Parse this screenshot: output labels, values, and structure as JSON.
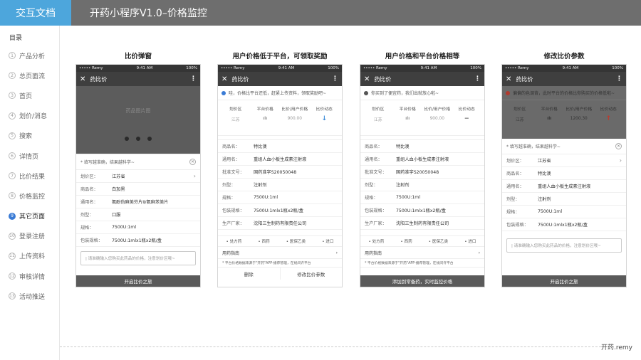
{
  "header": {
    "brand": "交互文档",
    "title": "开药小程序V1.0–价格监控"
  },
  "sidebar": {
    "title": "目录",
    "items": [
      {
        "num": "1",
        "label": "产品分析"
      },
      {
        "num": "2",
        "label": "总页面流"
      },
      {
        "num": "3",
        "label": "首页"
      },
      {
        "num": "4",
        "label": "划价/消息"
      },
      {
        "num": "5",
        "label": "搜索"
      },
      {
        "num": "6",
        "label": "详情页"
      },
      {
        "num": "7",
        "label": "比价结果"
      },
      {
        "num": "8",
        "label": "价格监控"
      },
      {
        "num": "9",
        "label": "其它页面",
        "active": true
      },
      {
        "num": "10",
        "label": "登录注册"
      },
      {
        "num": "11",
        "label": "上传资料"
      },
      {
        "num": "12",
        "label": "审核详情"
      },
      {
        "num": "13",
        "label": "活动推送"
      }
    ]
  },
  "footer": {
    "text": "开药.remy"
  },
  "colors": {
    "brand": "#4da6dc",
    "topbar": "#6e6e6e",
    "active": "#3a7bd5",
    "down_arrow": "#3a8ad8",
    "up_arrow": "#c0392b",
    "info_blue": "#3a7bd5",
    "info_dark": "#555555",
    "info_red": "#b03a2e"
  },
  "status_bar": {
    "carrier": "••••• Remy",
    "time": "9:41 AM",
    "battery": "100%"
  },
  "nav": {
    "close": "✕",
    "title": "药比价",
    "more": "⋮"
  },
  "screens": [
    {
      "title": "比价弹窗",
      "banner_placeholder": "药品图片图",
      "hint": "* 填写越准确，结果越科学~",
      "rows": [
        {
          "k": "划价区：",
          "v": "江苏省",
          "arrow": "›"
        },
        {
          "k": "商品名：",
          "v": "白加黑"
        },
        {
          "k": "通用名：",
          "v": "氨酚伪麻美芬片Ⅱ/氨麻苯美片"
        },
        {
          "k": "剂型：",
          "v": "口服"
        },
        {
          "k": "规格：",
          "v": "7500U:1ml"
        },
        {
          "k": "包装规格：",
          "v": "7500U:1mlx1瓶x2瓶/盒"
        }
      ],
      "input_placeholder": "| 请准确输入您购买此药品的价格，注意划价区哦~",
      "button": "开启比价之旅"
    },
    {
      "title": "用户价格低于平台，可领取奖励",
      "notice": "哇，价格比平台还低，赶紧上传资料，领取奖励吧~",
      "table_head": [
        "划价区",
        "平台价格",
        "比价/用户价格",
        "比价动态"
      ],
      "table_row": [
        "江苏",
        "",
        "900.00",
        "↓"
      ],
      "rows": [
        {
          "k": "商品名：",
          "v": "特比澳"
        },
        {
          "k": "通用名：",
          "v": "重组人血小板生成素注射液"
        },
        {
          "k": "批准文号：",
          "v": "国药准字S20050048"
        },
        {
          "k": "剂型：",
          "v": "注射剂"
        },
        {
          "k": "规格：",
          "v": "7500U:1ml"
        },
        {
          "k": "包装规格：",
          "v": "7500U:1mlx1瓶x2瓶/盒"
        },
        {
          "k": "生产厂家：",
          "v": "沈阳三生制药有限责任公司"
        }
      ],
      "tags": [
        "• 处方药",
        "• 西药",
        "• 医保乙类",
        "• 进口"
      ],
      "guide": "用药指南",
      "note": "* 平台价格数据来源于\"开药\"APP-播荐管理，在规间许平台",
      "btn_left": "删除",
      "btn_right": "修改比价参数"
    },
    {
      "title": "用户价格和平台价格相等",
      "notice": "你买到了便宜药，我们出就放心啦~",
      "table_head": [
        "划价区",
        "平台价格",
        "比价/用户价格",
        "比价动态"
      ],
      "table_row": [
        "江苏",
        "",
        "900.00",
        "—"
      ],
      "rows": [
        {
          "k": "商品名：",
          "v": "特比澳"
        },
        {
          "k": "通用名：",
          "v": "重组人血小板生成素注射液"
        },
        {
          "k": "批准文号：",
          "v": "国药准字S20050048"
        },
        {
          "k": "剂型：",
          "v": "注射剂"
        },
        {
          "k": "规格：",
          "v": "7500U:1ml"
        },
        {
          "k": "包装规格：",
          "v": "7500U:1mlx1瓶x2瓶/盒"
        },
        {
          "k": "生产厂家：",
          "v": "沈阳三生制药有限责任公司"
        }
      ],
      "tags": [
        "• 处方药",
        "• 西药",
        "• 医保乙类",
        "• 进口"
      ],
      "guide": "用药指南",
      "note": "* 平台价格数据来源于\"开药\"APP-播荐管理，在规间许平台",
      "button": "添加到常备药，实时监控价格"
    },
    {
      "title": "修改比价参数",
      "notice": "偏偏的色调背，此时平台的价格比你购买的价格低啦~",
      "table_head": [
        "划价区",
        "平台价格",
        "比价/用户价格",
        "比价动态"
      ],
      "table_row": [
        "江苏",
        "",
        "1200.30",
        "↑"
      ],
      "hint": "* 填写越准确，结果越科学~",
      "rows": [
        {
          "k": "划价区：",
          "v": "江苏省",
          "arrow": "›"
        },
        {
          "k": "商品名：",
          "v": "特比澳"
        },
        {
          "k": "通用名：",
          "v": "重组人血小板生成素注射液"
        },
        {
          "k": "剂型：",
          "v": "注射剂"
        },
        {
          "k": "规格：",
          "v": "7500U:1ml"
        },
        {
          "k": "包装规格：",
          "v": "7500U:1mlx1瓶x2瓶/盒"
        }
      ],
      "input_placeholder": "| 请准确输入您购买此药品的价格，注意划价区哦~",
      "button": "开启比价之旅"
    }
  ]
}
